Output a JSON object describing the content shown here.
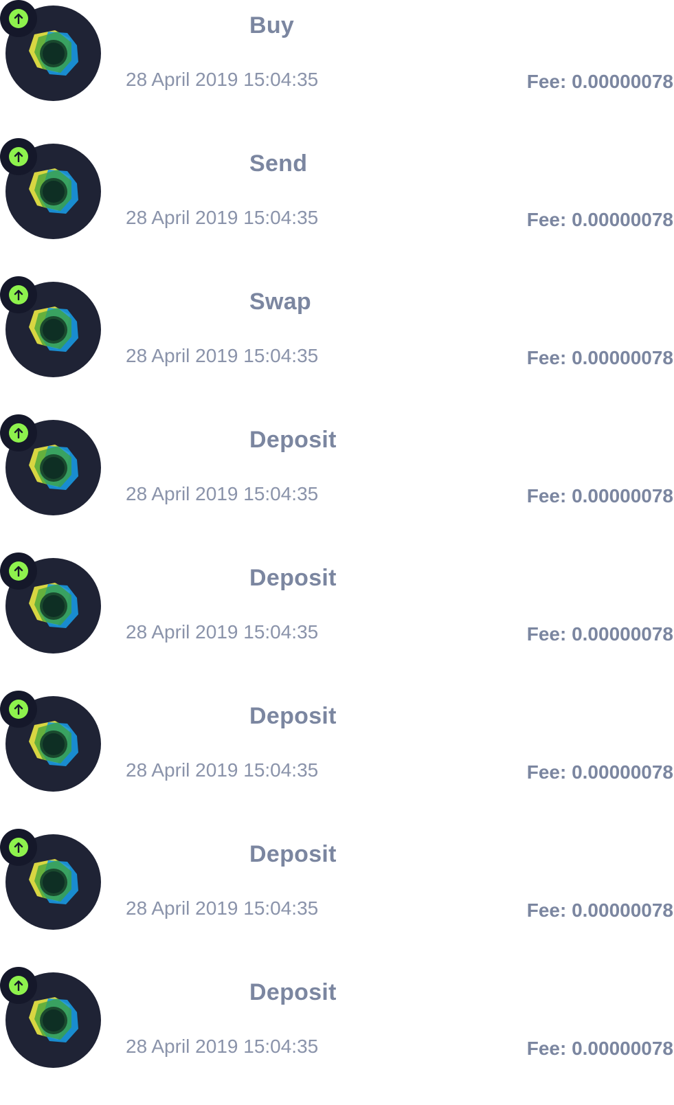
{
  "transactions": [
    {
      "type": "Buy",
      "date": "28 April 2019 15:04:35",
      "fee": "Fee: 0.00000078",
      "direction_icon": "arrow-up-icon",
      "coin_icon": "coin-logo-icon"
    },
    {
      "type": "Send",
      "date": "28 April 2019 15:04:35",
      "fee": "Fee: 0.00000078",
      "direction_icon": "arrow-up-icon",
      "coin_icon": "coin-logo-icon"
    },
    {
      "type": "Swap",
      "date": "28 April 2019 15:04:35",
      "fee": "Fee: 0.00000078",
      "direction_icon": "arrow-up-icon",
      "coin_icon": "coin-logo-icon"
    },
    {
      "type": "Deposit",
      "date": "28 April 2019 15:04:35",
      "fee": "Fee: 0.00000078",
      "direction_icon": "arrow-up-icon",
      "coin_icon": "coin-logo-icon"
    },
    {
      "type": "Deposit",
      "date": "28 April 2019 15:04:35",
      "fee": "Fee: 0.00000078",
      "direction_icon": "arrow-up-icon",
      "coin_icon": "coin-logo-icon"
    },
    {
      "type": "Deposit",
      "date": "28 April 2019 15:04:35",
      "fee": "Fee: 0.00000078",
      "direction_icon": "arrow-up-icon",
      "coin_icon": "coin-logo-icon"
    },
    {
      "type": "Deposit",
      "date": "28 April 2019 15:04:35",
      "fee": "Fee: 0.00000078",
      "direction_icon": "arrow-up-icon",
      "coin_icon": "coin-logo-icon"
    },
    {
      "type": "Deposit",
      "date": "28 April 2019 15:04:35",
      "fee": "Fee: 0.00000078",
      "direction_icon": "arrow-up-icon",
      "coin_icon": "coin-logo-icon"
    }
  ],
  "colors": {
    "coin_background": "#1f2335",
    "badge_accent": "#8ef24d",
    "logo_yellow": "#e3e043",
    "logo_green": "#3fa33c",
    "logo_blue": "#1898e0",
    "text_primary": "#7b86a0",
    "text_secondary": "#8a93aa"
  }
}
